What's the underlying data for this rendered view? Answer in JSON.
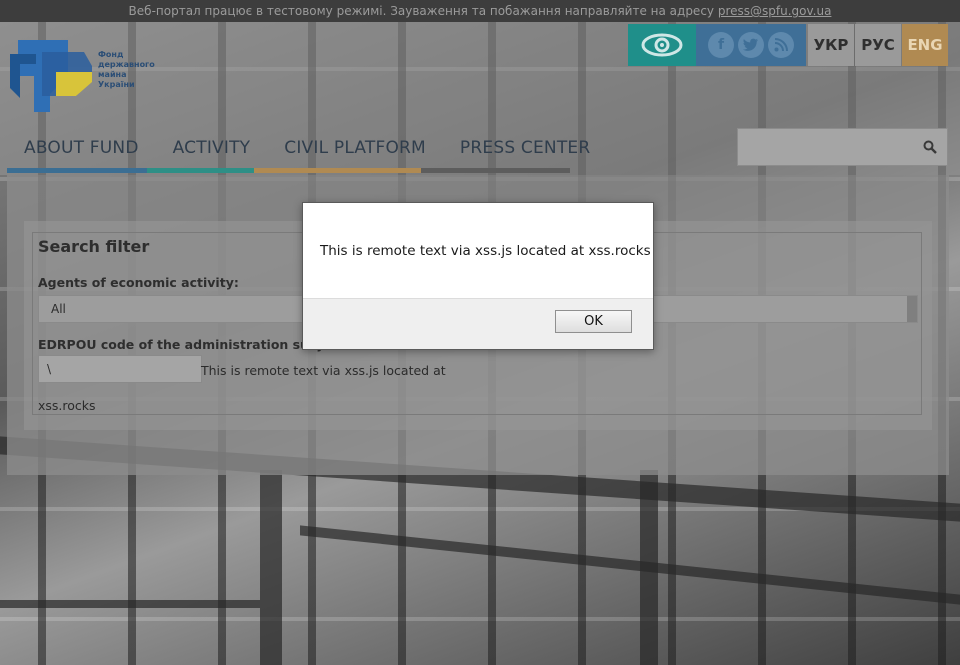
{
  "topbar": {
    "notice": "Веб-портал працює в тестовому режимі. Зауваження та побажання направляйте на адресу",
    "email": "press@spfu.gov.ua"
  },
  "logo": {
    "line1": "Фонд",
    "line2": "державного",
    "line3": "майна",
    "line4": "України"
  },
  "header": {
    "accessibility_icon": "eye-icon",
    "social_icons": [
      "facebook-icon",
      "twitter-icon",
      "rss-icon"
    ],
    "languages": [
      {
        "label": "УКР",
        "active": false
      },
      {
        "label": "РУС",
        "active": false
      },
      {
        "label": "ENG",
        "active": true
      }
    ]
  },
  "nav": {
    "items": [
      "ABOUT FUND",
      "ACTIVITY",
      "CIVIL PLATFORM",
      "PRESS CENTER"
    ]
  },
  "search": {
    "placeholder": "",
    "icon": "search-icon"
  },
  "filter": {
    "title": "Search filter",
    "agents_label": "Agents of economic activity:",
    "agents_value": "All",
    "edrpou_label": "EDRPOU code of the administration subject:",
    "edrpou_value": "\\",
    "injected_text_1": "This is remote text via xss.js located at",
    "injected_text_2": "xss.rocks"
  },
  "dialog": {
    "message": "This is remote text via xss.js located at xss.rocks",
    "ok_label": "OK"
  },
  "colors": {
    "accent_teal": "#1f8f8a",
    "social_blue": "#3f6f97",
    "lang_active": "#b08a52"
  }
}
